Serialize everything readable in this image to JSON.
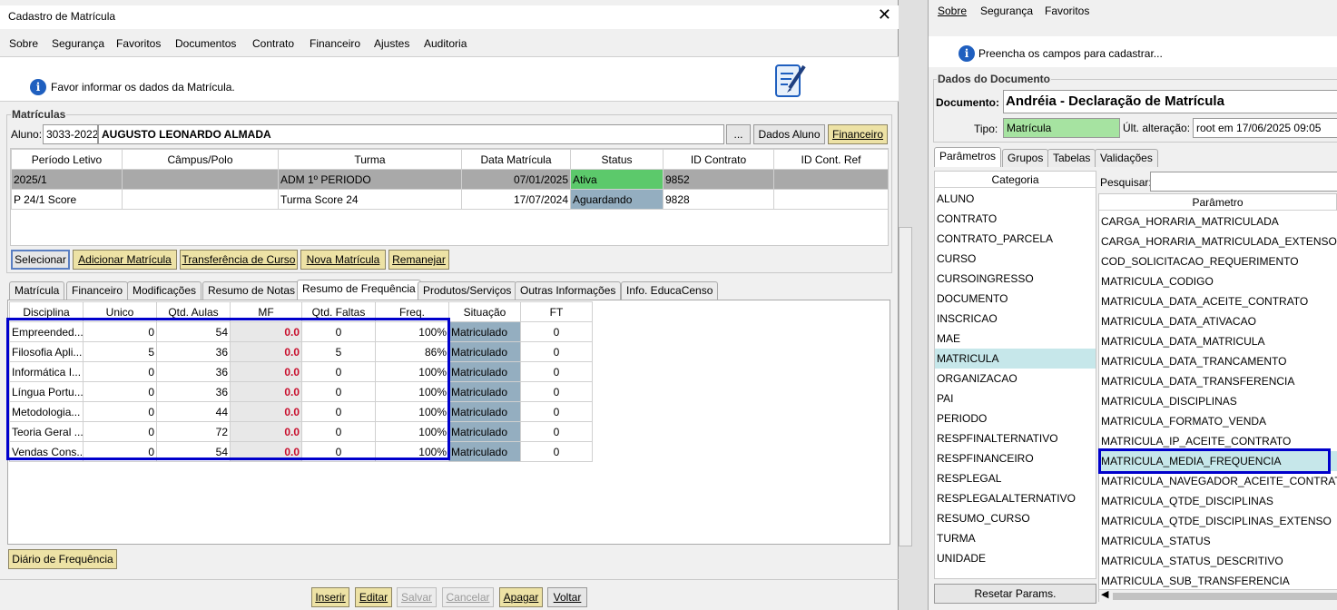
{
  "main": {
    "title": "Cadastro de Matrícula",
    "menu": [
      "Sobre",
      "Segurança",
      "Favoritos",
      "Documentos",
      "Contrato",
      "Financeiro",
      "Ajustes",
      "Auditoria"
    ],
    "info": "Favor informar os dados da Matrícula.",
    "matriculas": {
      "group_label": "Matrículas",
      "aluno_label": "Aluno:",
      "aluno_code": "3033-2022",
      "aluno_name": "AUGUSTO LEONARDO ALMADA",
      "ellipsis": "...",
      "dados_aluno": "Dados Aluno",
      "financeiro": "Financeiro",
      "columns": [
        "Período Letivo",
        "Câmpus/Polo",
        "Turma",
        "Data Matrícula",
        "Status",
        "ID Contrato",
        "ID Cont. Ref"
      ],
      "rows": [
        {
          "periodo": "2025/1",
          "campus": "",
          "turma": "ADM 1º PERIODO",
          "data": "07/01/2025",
          "status": "Ativa",
          "id": "9852",
          "ref": ""
        },
        {
          "periodo": "P 24/1 Score",
          "campus": "",
          "turma": "Turma Score 24",
          "data": "17/07/2024",
          "status": "Aguardando",
          "id": "9828",
          "ref": ""
        }
      ]
    },
    "actions": [
      "Selecionar",
      "Adicionar Matrícula",
      "Transferência de Curso",
      "Nova Matrícula",
      "Remanejar"
    ],
    "tabs": [
      "Matrícula",
      "Financeiro",
      "Modificações",
      "Resumo de Notas",
      "Resumo de Frequência",
      "Produtos/Serviços",
      "Outras Informações",
      "Info. EducaCenso"
    ],
    "freq": {
      "columns": [
        "Disciplina",
        "Unico",
        "Qtd. Aulas",
        "MF",
        "Qtd. Faltas",
        "Freq.",
        "Situação",
        "FT"
      ],
      "rows": [
        {
          "disc": "Empreended...",
          "unico": "0",
          "aulas": "54",
          "mf": "0.0",
          "faltas": "0",
          "freq": "100%",
          "sit": "Matriculado",
          "ft": "0"
        },
        {
          "disc": "Filosofia Apli...",
          "unico": "5",
          "aulas": "36",
          "mf": "0.0",
          "faltas": "5",
          "freq": "86%",
          "sit": "Matriculado",
          "ft": "0"
        },
        {
          "disc": "Informática I...",
          "unico": "0",
          "aulas": "36",
          "mf": "0.0",
          "faltas": "0",
          "freq": "100%",
          "sit": "Matriculado",
          "ft": "0"
        },
        {
          "disc": "Língua Portu...",
          "unico": "0",
          "aulas": "36",
          "mf": "0.0",
          "faltas": "0",
          "freq": "100%",
          "sit": "Matriculado",
          "ft": "0"
        },
        {
          "disc": "Metodologia...",
          "unico": "0",
          "aulas": "44",
          "mf": "0.0",
          "faltas": "0",
          "freq": "100%",
          "sit": "Matriculado",
          "ft": "0"
        },
        {
          "disc": "Teoria Geral ...",
          "unico": "0",
          "aulas": "72",
          "mf": "0.0",
          "faltas": "0",
          "freq": "100%",
          "sit": "Matriculado",
          "ft": "0"
        },
        {
          "disc": "Vendas Cons...",
          "unico": "0",
          "aulas": "54",
          "mf": "0.0",
          "faltas": "0",
          "freq": "100%",
          "sit": "Matriculado",
          "ft": "0"
        }
      ]
    },
    "diario": "Diário de Frequência",
    "bottom": [
      "Inserir",
      "Editar",
      "Salvar",
      "Cancelar",
      "Apagar",
      "Voltar"
    ]
  },
  "right": {
    "menu": [
      "Sobre",
      "Segurança",
      "Favoritos"
    ],
    "info": "Preencha os campos para cadastrar...",
    "group_label": "Dados do Documento",
    "documento_label": "Documento:",
    "documento": "Andréia - Declaração de Matrícula",
    "tipo_label": "Tipo:",
    "tipo": "Matrícula",
    "alt_label": "Últ. alteração:",
    "alt": "root em 17/06/2025 09:05",
    "tabs": [
      "Parâmetros",
      "Grupos",
      "Tabelas",
      "Validações"
    ],
    "categoria_header": "Categoria",
    "categorias": [
      "ALUNO",
      "CONTRATO",
      "CONTRATO_PARCELA",
      "CURSO",
      "CURSOINGRESSO",
      "DOCUMENTO",
      "INSCRICAO",
      "MAE",
      "MATRICULA",
      "ORGANIZACAO",
      "PAI",
      "PERIODO",
      "RESPFINALTERNATIVO",
      "RESPFINANCEIRO",
      "RESPLEGAL",
      "RESPLEGALALTERNATIVO",
      "RESUMO_CURSO",
      "TURMA",
      "UNIDADE"
    ],
    "pesquisar": "Pesquisar:",
    "param_header": "Parâmetro",
    "parametros": [
      "CARGA_HORARIA_MATRICULADA",
      "CARGA_HORARIA_MATRICULADA_EXTENSO",
      "COD_SOLICITACAO_REQUERIMENTO",
      "MATRICULA_CODIGO",
      "MATRICULA_DATA_ACEITE_CONTRATO",
      "MATRICULA_DATA_ATIVACAO",
      "MATRICULA_DATA_MATRICULA",
      "MATRICULA_DATA_TRANCAMENTO",
      "MATRICULA_DATA_TRANSFERENCIA",
      "MATRICULA_DISCIPLINAS",
      "MATRICULA_FORMATO_VENDA",
      "MATRICULA_IP_ACEITE_CONTRATO",
      "MATRICULA_MEDIA_FREQUENCIA",
      "MATRICULA_NAVEGADOR_ACEITE_CONTRATO",
      "MATRICULA_QTDE_DISCIPLINAS",
      "MATRICULA_QTDE_DISCIPLINAS_EXTENSO",
      "MATRICULA_STATUS",
      "MATRICULA_STATUS_DESCRITIVO",
      "MATRICULA_SUB_TRANSFERENCIA"
    ],
    "reset": "Resetar Params.",
    "colors": {
      "tipo_bg": "#a6e3a1",
      "highlight": "#c6e7ea",
      "selection_box": "#0000cc"
    }
  }
}
